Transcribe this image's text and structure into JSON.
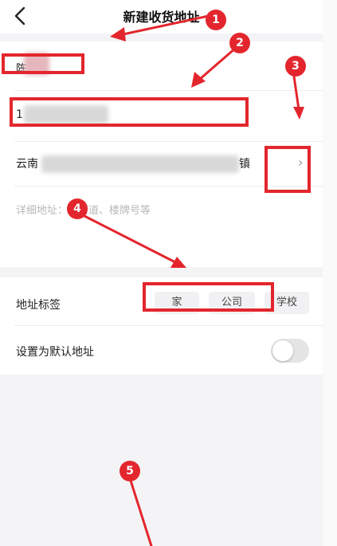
{
  "navbar": {
    "title": "新建收货地址",
    "back_icon": "chevron-left-icon"
  },
  "form": {
    "name_value": "陈",
    "phone_value": "1",
    "region_start": "云南",
    "region_end": "镇",
    "region_chevron": "›",
    "detail_placeholder": "详细地址：如街道、楼牌号等"
  },
  "tags": {
    "label": "地址标签",
    "options": [
      "家",
      "公司",
      "学校"
    ]
  },
  "default_address": {
    "label": "设置为默认地址",
    "enabled": false
  },
  "annotations": {
    "color": "#e3262d",
    "badges": [
      "1",
      "2",
      "3",
      "4",
      "5"
    ]
  }
}
